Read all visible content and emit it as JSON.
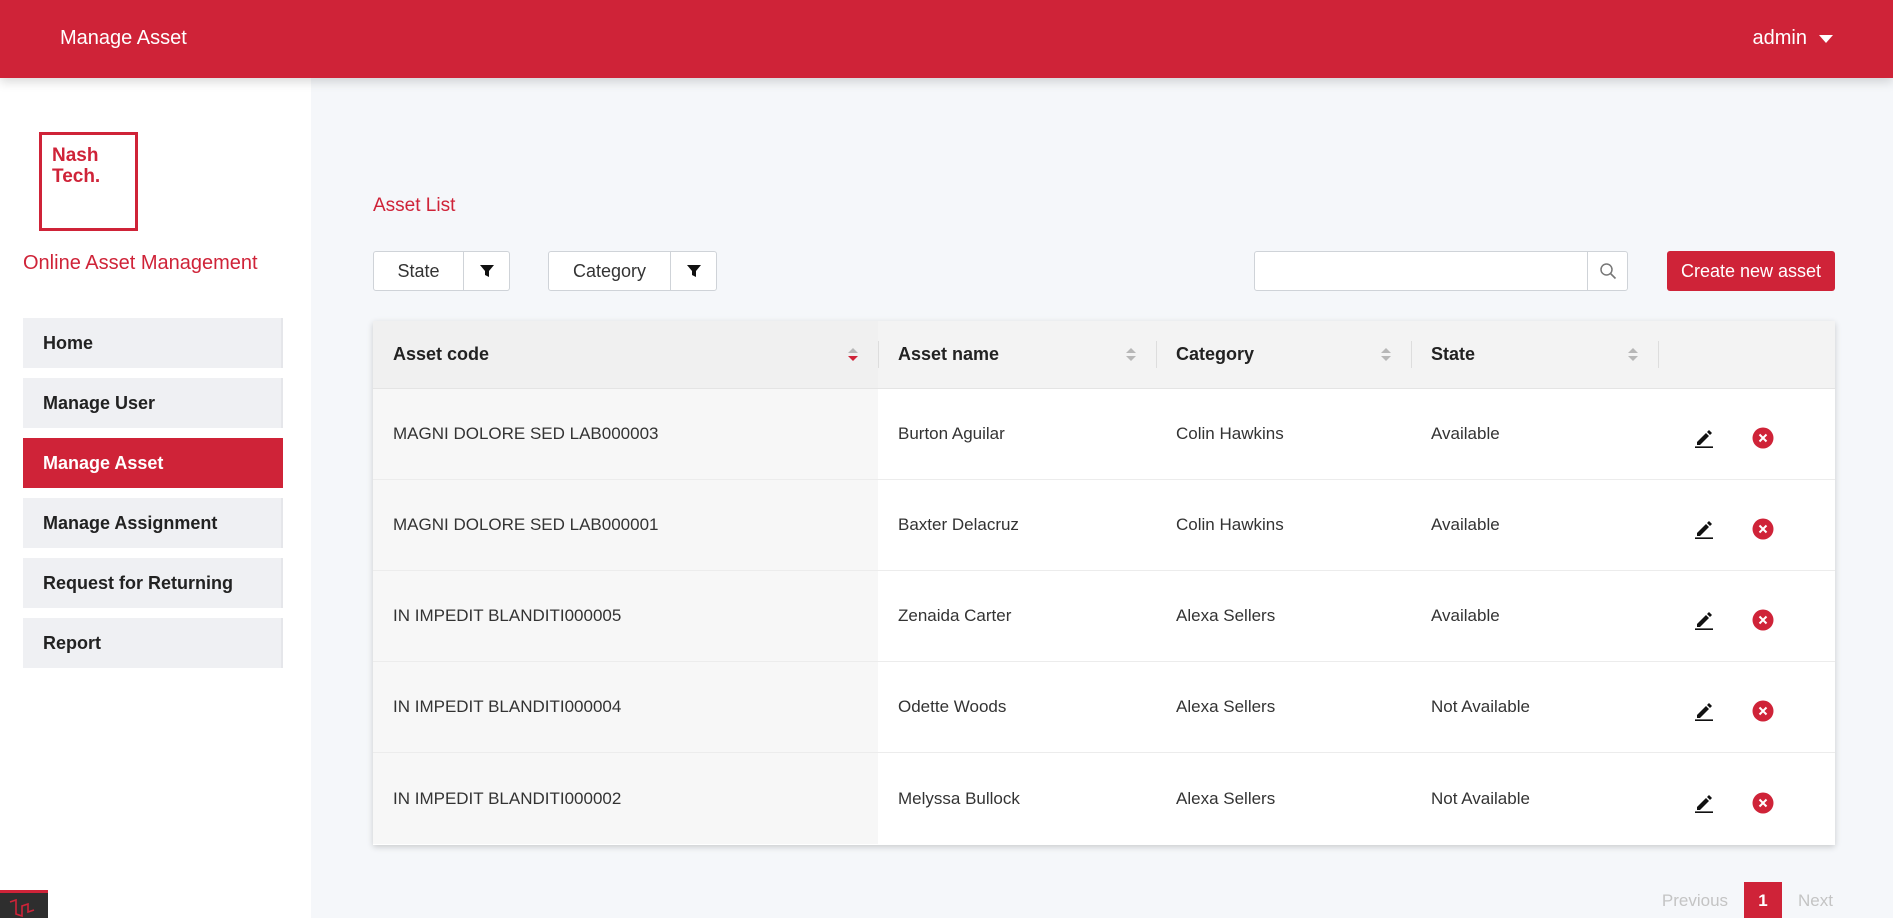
{
  "header": {
    "title": "Manage Asset",
    "user": "admin"
  },
  "sidebar": {
    "logo_text": "Nash\nTech.",
    "app_name": "Online Asset Management",
    "items": [
      {
        "label": "Home"
      },
      {
        "label": "Manage User"
      },
      {
        "label": "Manage Asset",
        "active": true
      },
      {
        "label": "Manage Assignment"
      },
      {
        "label": "Request for Returning"
      },
      {
        "label": "Report"
      }
    ]
  },
  "main": {
    "section_title": "Asset List",
    "filters": {
      "state_label": "State",
      "category_label": "Category"
    },
    "search": {
      "value": "",
      "placeholder": ""
    },
    "create_button": "Create new asset",
    "table": {
      "columns": [
        "Asset code",
        "Asset name",
        "Category",
        "State"
      ],
      "sorted_column": "Asset code",
      "rows": [
        {
          "code": "MAGNI DOLORE SED LAB000003",
          "name": "Burton Aguilar",
          "category": "Colin Hawkins",
          "state": "Available"
        },
        {
          "code": "MAGNI DOLORE SED LAB000001",
          "name": "Baxter Delacruz",
          "category": "Colin Hawkins",
          "state": "Available"
        },
        {
          "code": "IN IMPEDIT BLANDITI000005",
          "name": "Zenaida Carter",
          "category": "Alexa Sellers",
          "state": "Available"
        },
        {
          "code": "IN IMPEDIT BLANDITI000004",
          "name": "Odette Woods",
          "category": "Alexa Sellers",
          "state": "Not Available"
        },
        {
          "code": "IN IMPEDIT BLANDITI000002",
          "name": "Melyssa Bullock",
          "category": "Alexa Sellers",
          "state": "Not Available"
        }
      ]
    },
    "pagination": {
      "previous": "Previous",
      "current_page": "1",
      "next": "Next"
    }
  },
  "colors": {
    "brand": "#cf2338",
    "background": "#f5f7fa",
    "nav_item": "#eff0f3"
  },
  "icons": [
    "caret-down-icon",
    "funnel-icon",
    "search-icon",
    "pencil-icon",
    "close-circle-icon",
    "laravel-icon"
  ]
}
